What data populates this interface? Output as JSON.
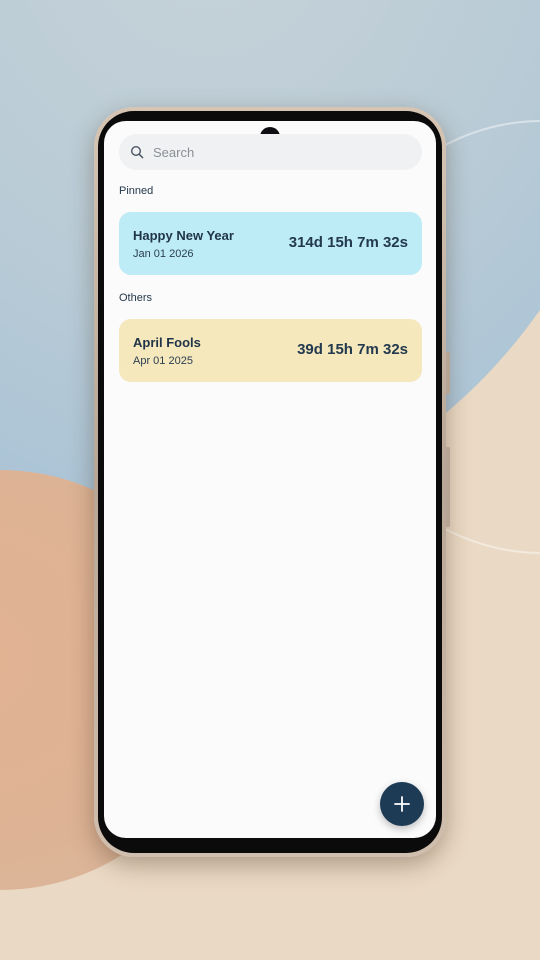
{
  "search": {
    "placeholder": "Search",
    "value": "",
    "icon": "search-icon"
  },
  "sections": {
    "pinned_label": "Pinned",
    "others_label": "Others"
  },
  "pinned_events": [
    {
      "title": "Happy New Year",
      "date": "Jan 01 2026",
      "countdown": "314d 15h 7m 32s",
      "color": "#bdebf6"
    }
  ],
  "other_events": [
    {
      "title": "April Fools",
      "date": "Apr 01 2025",
      "countdown": "39d 15h 7m 32s",
      "color": "#f6e8bd"
    }
  ],
  "fab": {
    "icon": "plus-icon",
    "color": "#1d3b55"
  },
  "theme": {
    "text_primary": "#1f3448",
    "screen_background": "#fbfbfb"
  }
}
